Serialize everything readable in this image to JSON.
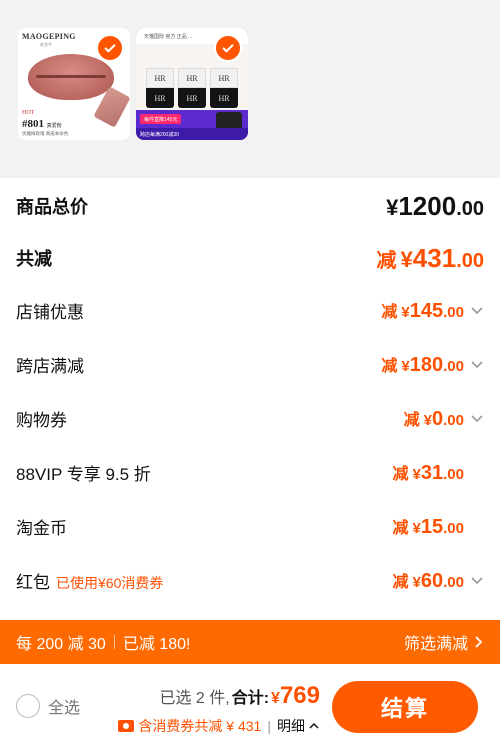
{
  "products": [
    {
      "brand": "MAOGEPING",
      "brand_sub": "毛戈平",
      "hot": "HOT",
      "shade": "#801",
      "shade_name": "真爱粉",
      "shade_desc": "优雅梅玫瑰 真皮本命色"
    },
    {
      "top_text": "天猫国际 官方 正品 ...",
      "jar_label": "HR",
      "promo_a": "每件直降145元",
      "promo_b": "跨店每满200减30",
      "gift": "赠品"
    }
  ],
  "breakdown": {
    "total": {
      "label": "商品总价",
      "currency": "¥",
      "int": "1200",
      "dec": ".00"
    },
    "reduce": {
      "label": "共减",
      "prefix": "减",
      "currency": "¥",
      "int": "431",
      "dec": ".00"
    },
    "items": [
      {
        "label": "店铺优惠",
        "note": "",
        "prefix": "减",
        "currency": "¥",
        "int": "145",
        "dec": ".00"
      },
      {
        "label": "跨店满减",
        "note": "",
        "prefix": "减",
        "currency": "¥",
        "int": "180",
        "dec": ".00"
      },
      {
        "label": "购物券",
        "note": "",
        "prefix": "减",
        "currency": "¥",
        "int": "0",
        "dec": ".00"
      },
      {
        "label": "88VIP 专享 9.5 折",
        "note": "",
        "prefix": "减",
        "currency": "¥",
        "int": "31",
        "dec": ".00"
      },
      {
        "label": "淘金币",
        "note": "",
        "prefix": "减",
        "currency": "¥",
        "int": "15",
        "dec": ".00"
      },
      {
        "label": "红包",
        "note": "已使用¥60消费券",
        "prefix": "减",
        "currency": "¥",
        "int": "60",
        "dec": ".00"
      }
    ]
  },
  "promo_bar": {
    "rule": "每 200 减 30",
    "achieved": "已减 180!",
    "filter": "筛选满减"
  },
  "footer": {
    "select_all": "全选",
    "selected_count": "已选 2 件,",
    "total_label": "合计:",
    "currency": "¥",
    "total": "769",
    "coupon_note": "含消费券共减 ¥ 431",
    "detail": "明细",
    "checkout": "结算"
  },
  "colors": {
    "accent": "#ff5000",
    "promo_bar": "#ff6a00",
    "checkout_button": "#ff5a00"
  }
}
